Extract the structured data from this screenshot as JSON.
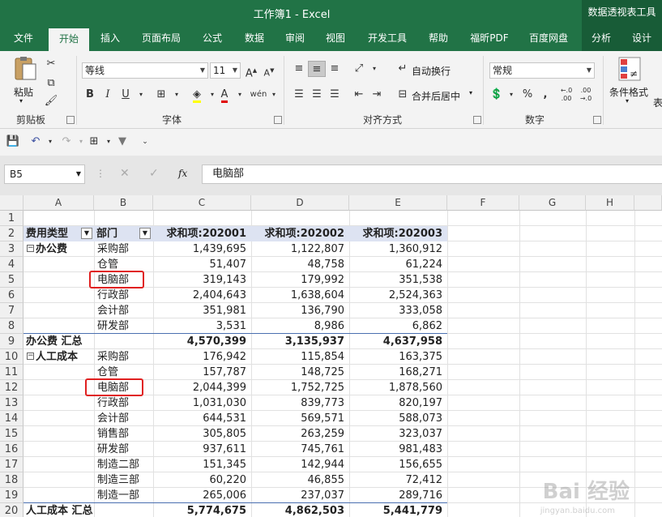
{
  "window": {
    "title": "工作簿1  -  Excel",
    "context_tool": "数据透视表工具"
  },
  "tabs": [
    "文件",
    "开始",
    "插入",
    "页面布局",
    "公式",
    "数据",
    "审阅",
    "视图",
    "开发工具",
    "帮助",
    "福昕PDF",
    "百度网盘"
  ],
  "context_tabs": [
    "分析",
    "设计"
  ],
  "active_tab": "开始",
  "ribbon": {
    "paste_label": "粘贴",
    "clipboard_group": "剪贴板",
    "font_group": "字体",
    "align_group": "对齐方式",
    "number_group": "数字",
    "font_name": "等线",
    "font_size": "11",
    "wrap_text": "自动换行",
    "merge_center": "合并后居中",
    "number_format": "常规",
    "cond_format": "条件格式",
    "table_fmt_partial": "表"
  },
  "formula_bar": {
    "name_box": "B5",
    "fx": "fx",
    "content": "电脑部"
  },
  "columns": [
    "A",
    "B",
    "C",
    "D",
    "E",
    "F",
    "G",
    "H"
  ],
  "rows": [
    "1",
    "2",
    "3",
    "4",
    "5",
    "6",
    "7",
    "8",
    "9",
    "10",
    "11",
    "12",
    "13",
    "14",
    "15",
    "16",
    "17",
    "18",
    "19",
    "20"
  ],
  "pivot": {
    "header": {
      "a": "费用类型",
      "b": "部门",
      "c": "求和项:202001",
      "d": "求和项:202002",
      "e": "求和项:202003"
    },
    "body": [
      {
        "a": "办公费",
        "b": "采购部",
        "c": "1,439,695",
        "d": "1,122,807",
        "e": "1,360,912"
      },
      {
        "a": "",
        "b": "仓管",
        "c": "51,407",
        "d": "48,758",
        "e": "61,224"
      },
      {
        "a": "",
        "b": "电脑部",
        "c": "319,143",
        "d": "179,992",
        "e": "351,538"
      },
      {
        "a": "",
        "b": "行政部",
        "c": "2,404,643",
        "d": "1,638,604",
        "e": "2,524,363"
      },
      {
        "a": "",
        "b": "会计部",
        "c": "351,981",
        "d": "136,790",
        "e": "333,058"
      },
      {
        "a": "",
        "b": "研发部",
        "c": "3,531",
        "d": "8,986",
        "e": "6,862"
      },
      {
        "a": "办公费 汇总",
        "b": "",
        "c": "4,570,399",
        "d": "3,135,937",
        "e": "4,637,958"
      },
      {
        "a": "人工成本",
        "b": "采购部",
        "c": "176,942",
        "d": "115,854",
        "e": "163,375"
      },
      {
        "a": "",
        "b": "仓管",
        "c": "157,787",
        "d": "148,725",
        "e": "168,271"
      },
      {
        "a": "",
        "b": "电脑部",
        "c": "2,044,399",
        "d": "1,752,725",
        "e": "1,878,560"
      },
      {
        "a": "",
        "b": "行政部",
        "c": "1,031,030",
        "d": "839,773",
        "e": "820,197"
      },
      {
        "a": "",
        "b": "会计部",
        "c": "644,531",
        "d": "569,571",
        "e": "588,073"
      },
      {
        "a": "",
        "b": "销售部",
        "c": "305,805",
        "d": "263,259",
        "e": "323,037"
      },
      {
        "a": "",
        "b": "研发部",
        "c": "937,611",
        "d": "745,761",
        "e": "981,483"
      },
      {
        "a": "",
        "b": "制造二部",
        "c": "151,345",
        "d": "142,944",
        "e": "156,655"
      },
      {
        "a": "",
        "b": "制造三部",
        "c": "60,220",
        "d": "46,855",
        "e": "72,412"
      },
      {
        "a": "",
        "b": "制造一部",
        "c": "265,006",
        "d": "237,037",
        "e": "289,716"
      },
      {
        "a": "人工成本 汇总",
        "b": "",
        "c": "5,774,675",
        "d": "4,862,503",
        "e": "5,441,779"
      }
    ]
  },
  "watermark": {
    "main": "Bai 经验",
    "sub": "jingyan.baidu.com"
  },
  "colors": {
    "excel_green": "#217346",
    "pivot_header_bg": "#dde3f2",
    "highlight": "#e02020"
  }
}
